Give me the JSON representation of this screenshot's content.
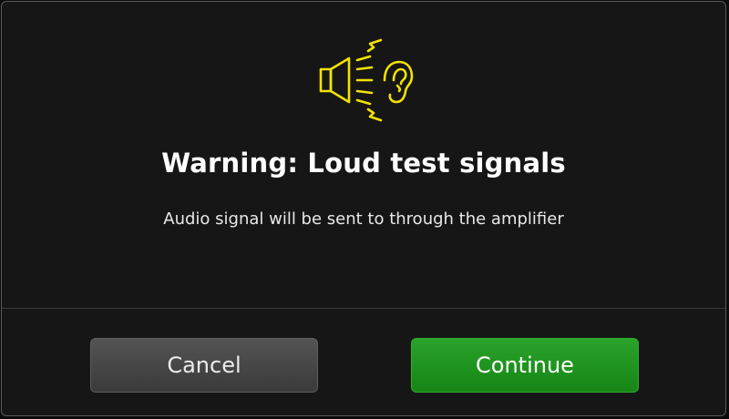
{
  "dialog": {
    "icon": "speaker-loud-ear-icon",
    "icon_color": "#f2e300",
    "title": "Warning: Loud test signals",
    "message": "Audio signal will be sent to through the amplifier"
  },
  "actions": {
    "cancel_label": "Cancel",
    "continue_label": "Continue",
    "continue_color": "#1e921e"
  }
}
